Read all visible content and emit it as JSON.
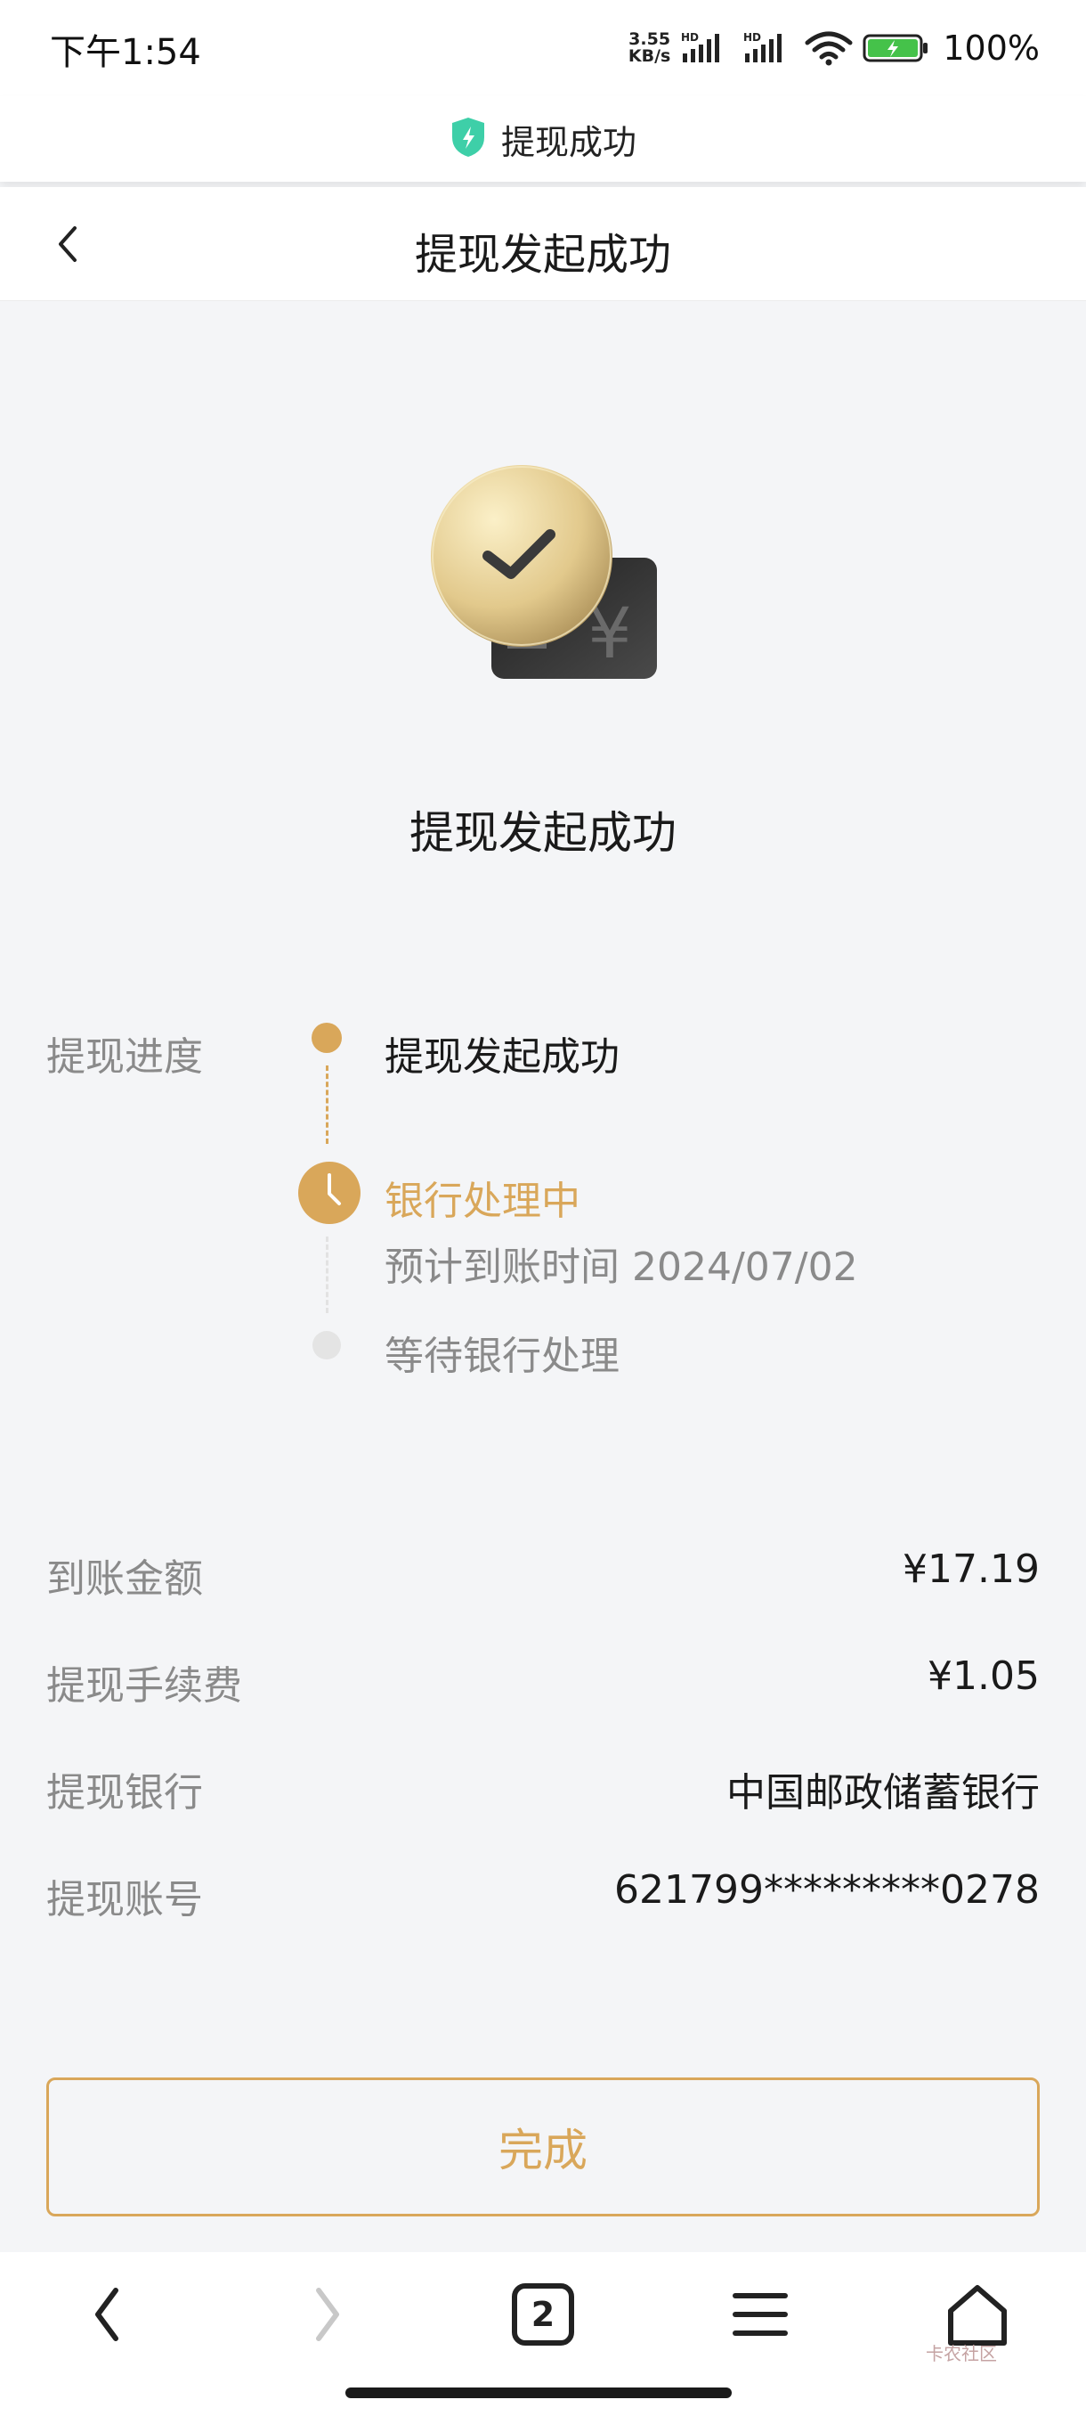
{
  "status_bar": {
    "time": "下午1:54",
    "net_speed_value": "3.55",
    "net_speed_unit": "KB/s",
    "signal_1_label": "HD",
    "signal_2_label": "HD",
    "battery_percent": "100%"
  },
  "secure_bar": {
    "title": "提现成功",
    "shield_color": "#3ecfa8"
  },
  "nav": {
    "title": "提现发起成功"
  },
  "hero": {
    "title": "提现发起成功",
    "card_symbol": "¥"
  },
  "progress": {
    "label": "提现进度",
    "steps": [
      {
        "title": "提现发起成功",
        "status": "done"
      },
      {
        "title": "银行处理中",
        "subtitle": "预计到账时间 2024/07/02",
        "status": "current"
      },
      {
        "title": "等待银行处理",
        "status": "pending"
      }
    ]
  },
  "details": [
    {
      "label": "到账金额",
      "value": "¥17.19"
    },
    {
      "label": "提现手续费",
      "value": "¥1.05"
    },
    {
      "label": "提现银行",
      "value": "中国邮政储蓄银行"
    },
    {
      "label": "提现账号",
      "value": "621799*********0278"
    }
  ],
  "done_button": {
    "label": "完成"
  },
  "browser_bar": {
    "tab_count": "2",
    "watermark": "卡农社区"
  },
  "colors": {
    "accent": "#d9a75a",
    "background": "#f4f5f7"
  }
}
